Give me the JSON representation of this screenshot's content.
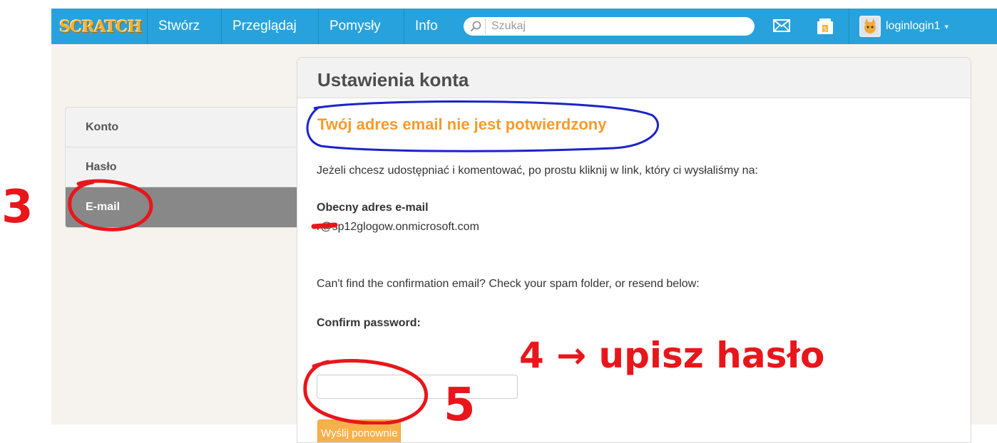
{
  "nav": {
    "logo": "SCRATCH",
    "items": [
      "Stwórz",
      "Przeglądaj",
      "Pomysły",
      "Info"
    ],
    "search_placeholder": "Szukaj",
    "username": "loginlogin1",
    "caret": "▾",
    "brand_color": "#27a2dc"
  },
  "sidebar": {
    "items": [
      {
        "label": "Konto",
        "active": false
      },
      {
        "label": "Hasło",
        "active": false
      },
      {
        "label": "E-mail",
        "active": true
      }
    ]
  },
  "main": {
    "title": "Ustawienia konta",
    "alert": "Twój adres email nie jest potwierdzony",
    "info": "Jeżeli chcesz udostępniać i komentować, po prostu kliknij w link, który ci wysłaliśmy na:",
    "current_label": "Obecny adres e-mail",
    "current_email": "r@sp12glogow.onmicrosoft.com",
    "resend_info": "Can't find the confirmation email? Check your spam folder, or resend below:",
    "confirm_label": "Confirm password:",
    "password_value": "",
    "resend_button": "Wyślij ponownie",
    "accent_color": "#f59b2b"
  },
  "annotations": {
    "step3": "3",
    "step4": "4 → upisz hasło",
    "step5": "5",
    "color": "#e8161b",
    "circle_color": "#1b23c9"
  }
}
